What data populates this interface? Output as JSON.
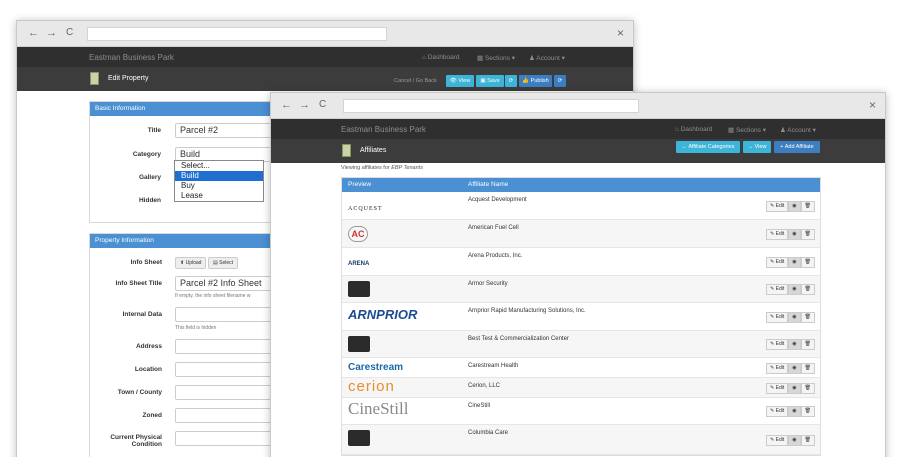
{
  "nav_glyphs": {
    "back": "←",
    "forward": "→",
    "reload": "C",
    "close": "×"
  },
  "back_window": {
    "brand": "Eastman Business Park",
    "menu": {
      "dashboard": "Dashboard",
      "sections": "Sections",
      "account": "Account"
    },
    "page_title": "Edit Property",
    "actions": {
      "cancel": "Cancel / Go Back",
      "view": "View",
      "save": "Save",
      "refresh": "⟳",
      "publish": "Publish",
      "publish_refresh": "⟳"
    },
    "basic_info": {
      "heading": "Basic Information",
      "title_label": "Title",
      "title_value": "Parcel #2",
      "category_label": "Category",
      "category_value": "Build",
      "category_options": [
        "Select...",
        "Build",
        "Buy",
        "Lease"
      ],
      "category_selected_index": 1,
      "gallery_label": "Gallery",
      "hidden_label": "Hidden"
    },
    "property_info": {
      "heading": "Property Information",
      "info_sheet_label": "Info Sheet",
      "upload_label": "Upload",
      "select_label": "Select",
      "info_sheet_title_label": "Info Sheet Title",
      "info_sheet_title_value": "Parcel #2 Info Sheet",
      "info_sheet_title_hint": "If empty, the info sheet filename w",
      "internal_data_label": "Internal Data",
      "internal_data_hint": "This field is hidden",
      "address_label": "Address",
      "location_label": "Location",
      "town_label": "Town / County",
      "zoned_label": "Zoned",
      "condition_label_line1": "Current Physical",
      "condition_label_line2": "Condition"
    }
  },
  "front_window": {
    "brand": "Eastman Business Park",
    "menu": {
      "dashboard": "Dashboard",
      "sections": "Sections",
      "account": "Account"
    },
    "page_title": "Affiliates",
    "actions": {
      "categories": "Affiliate Categories",
      "view": "View",
      "add": "+ Add Affiliate"
    },
    "subtitle_prefix": "Viewing affiliates for",
    "subtitle_target": "EBP Tenants",
    "table": {
      "columns": [
        "Preview",
        "Affiliate Name"
      ],
      "edit_label": "Edit",
      "eye_glyph": "◉",
      "trash_glyph": "🗑",
      "rows": [
        {
          "name": "Acquest Development",
          "logo": "ACQUEST"
        },
        {
          "name": "American Fuel Cell",
          "logo": "AC"
        },
        {
          "name": "Arena Products, Inc.",
          "logo": "ARENA"
        },
        {
          "name": "Armor Security",
          "logo": ""
        },
        {
          "name": "Arnprior Rapid Manufacturing Solutions, Inc.",
          "logo": "ARNPRIOR"
        },
        {
          "name": "Best Test & Commercialization Center",
          "logo": ""
        },
        {
          "name": "Carestream Health",
          "logo": "Carestream"
        },
        {
          "name": "Cerion, LLC",
          "logo": "cerion"
        },
        {
          "name": "CineStill",
          "logo": "CineStill"
        },
        {
          "name": "Columbia Care",
          "logo": ""
        }
      ]
    }
  },
  "colors": {
    "accent_blue": "#4a90d2",
    "button_cyan": "#3db5d8",
    "navbar": "#2f2f2f"
  }
}
